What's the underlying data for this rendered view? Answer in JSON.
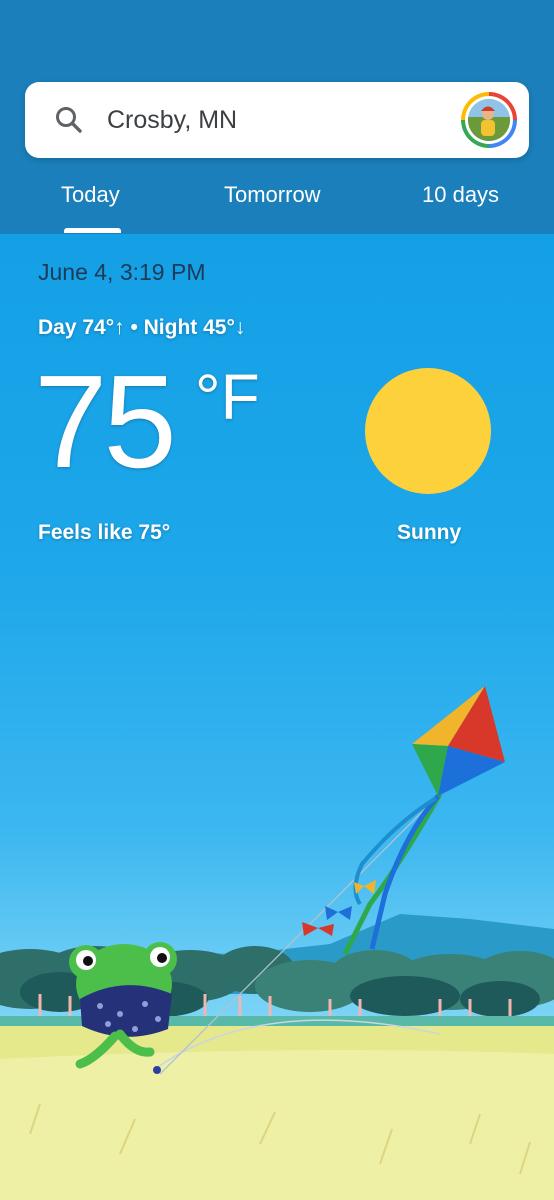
{
  "search": {
    "location": "Crosby, MN",
    "search_icon": "search-icon",
    "avatar_icon": "account-avatar"
  },
  "tabs": [
    {
      "label": "Today",
      "selected": true
    },
    {
      "label": "Tomorrow",
      "selected": false
    },
    {
      "label": "10 days",
      "selected": false
    }
  ],
  "weather": {
    "datetime": "June 4, 3:19 PM",
    "day_night": "Day 74°↑ • Night 45°↓",
    "temperature": "75",
    "unit": "°F",
    "feels_like": "Feels like 75°",
    "condition": "Sunny",
    "condition_icon": "sun-icon"
  },
  "colors": {
    "header": "#1a7fba",
    "sky_top": "#14a0e6",
    "sun": "#fcd13c"
  },
  "illustration": "frog-flying-kite"
}
